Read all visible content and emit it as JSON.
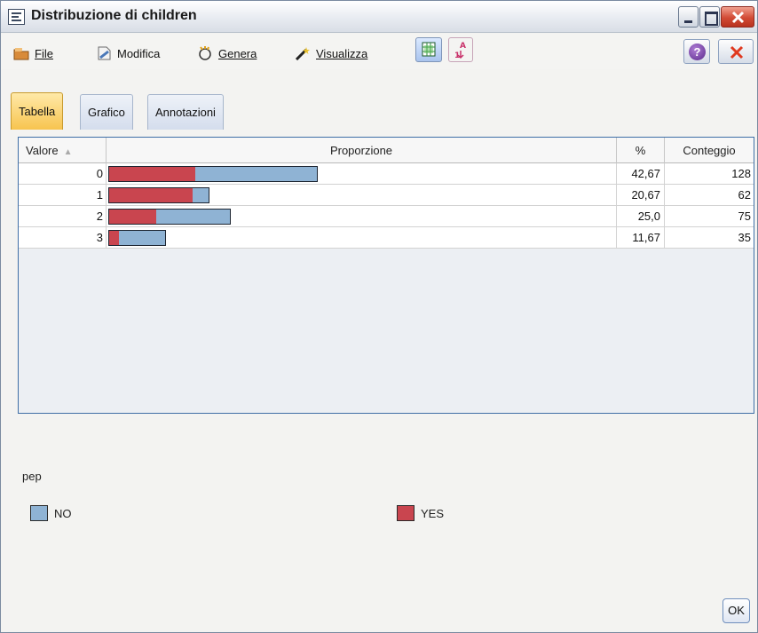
{
  "window": {
    "title": "Distribuzione di children"
  },
  "menu": {
    "file": "File",
    "modifica": "Modifica",
    "genera": "Genera",
    "visualizza": "Visualizza"
  },
  "tabs": [
    "Tabella",
    "Grafico",
    "Annotazioni"
  ],
  "table": {
    "headers": {
      "valore": "Valore",
      "proporzione": "Proporzione",
      "percent": "%",
      "conteggio": "Conteggio"
    },
    "rows": [
      {
        "valore": "0",
        "percent": "42,67",
        "conteggio": "128",
        "no": 75,
        "yes": 53
      },
      {
        "valore": "1",
        "percent": "20,67",
        "conteggio": "62",
        "no": 10,
        "yes": 52
      },
      {
        "valore": "2",
        "percent": "25,0",
        "conteggio": "75",
        "no": 46,
        "yes": 29
      },
      {
        "valore": "3",
        "percent": "11,67",
        "conteggio": "35",
        "no": 29,
        "yes": 6
      }
    ],
    "max_count": 128
  },
  "legend": {
    "title": "pep",
    "items": [
      {
        "label": "NO",
        "color": "#8fb3d4"
      },
      {
        "label": "YES",
        "color": "#c9454f"
      }
    ]
  },
  "ok_label": "OK"
}
